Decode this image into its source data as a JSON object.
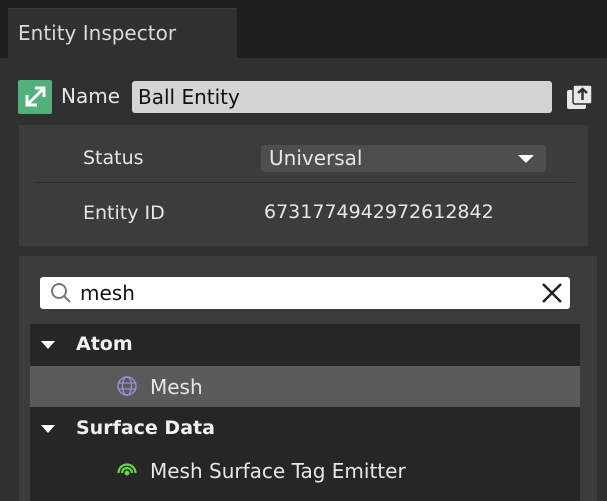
{
  "tab": {
    "title": "Entity Inspector"
  },
  "entity": {
    "name_label": "Name",
    "name_value": "Ball Entity"
  },
  "properties": {
    "status_label": "Status",
    "status_value": "Universal",
    "entity_id_label": "Entity ID",
    "entity_id_value": "6731774942972612842"
  },
  "search": {
    "value": "mesh",
    "placeholder": ""
  },
  "tree": {
    "categories": [
      {
        "label": "Atom",
        "items": [
          {
            "label": "Mesh",
            "icon": "mesh-icon",
            "selected": true
          }
        ]
      },
      {
        "label": "Surface Data",
        "items": [
          {
            "label": "Mesh Surface Tag Emitter",
            "icon": "surface-tag-emitter-icon",
            "selected": false
          }
        ]
      }
    ]
  },
  "colors": {
    "entity_icon": "#52b17a",
    "selected_row": "#5a5a5a",
    "emitter_icon": "#6ad44a",
    "mesh_icon": "#9c8fd0"
  }
}
